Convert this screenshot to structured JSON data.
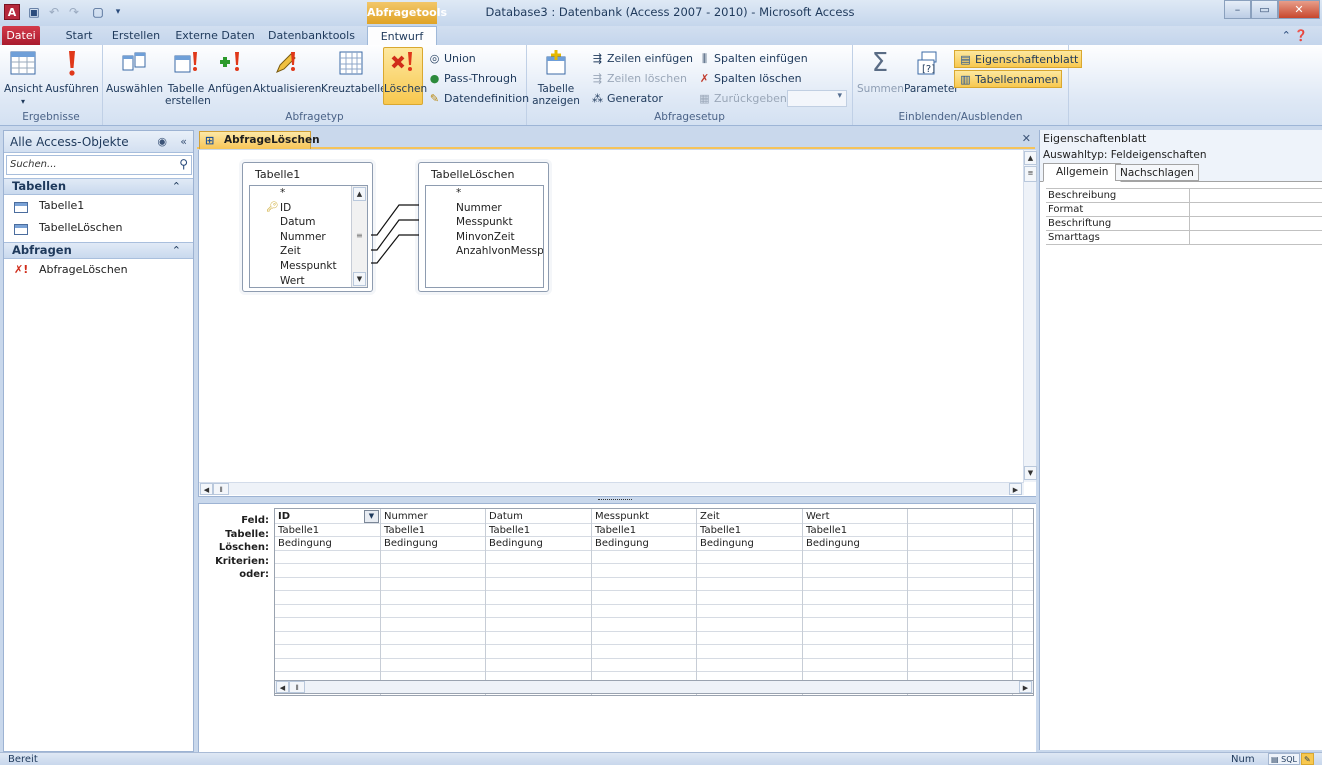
{
  "window": {
    "title": "Database3 : Datenbank (Access 2007 - 2010)  -  Microsoft Access",
    "context_tab_group": "Abfragetools",
    "app_icon_letter": "A"
  },
  "ribbon_tabs": [
    "Datei",
    "Start",
    "Erstellen",
    "Externe Daten",
    "Datenbanktools",
    "Entwurf"
  ],
  "ribbon": {
    "ergebnisse": {
      "label": "Ergebnisse",
      "ansicht": "Ansicht",
      "ausfuehren": "Ausführen"
    },
    "abfragetyp": {
      "label": "Abfragetyp",
      "auswaehlen": "Auswählen",
      "tabelle_line1": "Tabelle",
      "tabelle_line2": "erstellen",
      "anfuegen": "Anfügen",
      "aktualisieren": "Aktualisieren",
      "kreuztabelle": "Kreuztabelle",
      "loeschen": "Löschen",
      "union": "Union",
      "pass_through": "Pass-Through",
      "datendefinition": "Datendefinition"
    },
    "abfragesetup": {
      "label": "Abfragesetup",
      "tabelle_anzeigen_line1": "Tabelle",
      "tabelle_anzeigen_line2": "anzeigen",
      "zeilen_einfuegen": "Zeilen einfügen",
      "zeilen_loeschen": "Zeilen löschen",
      "generator": "Generator",
      "spalten_einfuegen": "Spalten einfügen",
      "spalten_loeschen": "Spalten löschen",
      "zurueckgeben": "Zurückgeben:"
    },
    "einblenden": {
      "label": "Einblenden/Ausblenden",
      "summen": "Summen",
      "parameter": "Parameter",
      "eigenschaftenblatt": "Eigenschaftenblatt",
      "tabellennamen": "Tabellennamen"
    }
  },
  "nav": {
    "header": "Alle Access-Objekte",
    "search_placeholder": "Suchen...",
    "groups": [
      {
        "name": "Tabellen",
        "items": [
          "Tabelle1",
          "TabelleLöschen"
        ]
      },
      {
        "name": "Abfragen",
        "items": [
          "AbfrageLöschen"
        ]
      }
    ]
  },
  "document": {
    "tab": "AbfrageLöschen",
    "tables": [
      {
        "name": "Tabelle1",
        "fields": [
          "*",
          "ID",
          "Datum",
          "Nummer",
          "Zeit",
          "Messpunkt",
          "Wert"
        ],
        "key_field": "ID"
      },
      {
        "name": "TabelleLöschen",
        "fields": [
          "*",
          "Nummer",
          "Messpunkt",
          "MinvonZeit",
          "AnzahlvonMesspunkt"
        ]
      }
    ]
  },
  "grid": {
    "row_labels": [
      "Feld:",
      "Tabelle:",
      "Löschen:",
      "Kriterien:",
      "oder:"
    ],
    "columns": [
      {
        "feld": "ID",
        "tabelle": "Tabelle1",
        "loeschen": "Bedingung"
      },
      {
        "feld": "Nummer",
        "tabelle": "Tabelle1",
        "loeschen": "Bedingung"
      },
      {
        "feld": "Datum",
        "tabelle": "Tabelle1",
        "loeschen": "Bedingung"
      },
      {
        "feld": "Messpunkt",
        "tabelle": "Tabelle1",
        "loeschen": "Bedingung"
      },
      {
        "feld": "Zeit",
        "tabelle": "Tabelle1",
        "loeschen": "Bedingung"
      },
      {
        "feld": "Wert",
        "tabelle": "Tabelle1",
        "loeschen": "Bedingung"
      },
      {
        "feld": "",
        "tabelle": "",
        "loeschen": ""
      }
    ]
  },
  "property_sheet": {
    "title": "Eigenschaftenblatt",
    "selection_type": "Auswahltyp:  Feldeigenschaften",
    "tabs": [
      "Allgemein",
      "Nachschlagen"
    ],
    "rows": [
      "Beschreibung",
      "Format",
      "Beschriftung",
      "Smarttags"
    ]
  },
  "status": {
    "left": "Bereit",
    "num": "Num",
    "sql": "SQL"
  },
  "colors": {
    "file_tab": "#b81f33",
    "context_highlight": "#f8c84f",
    "frame": "#c9d8ec"
  }
}
